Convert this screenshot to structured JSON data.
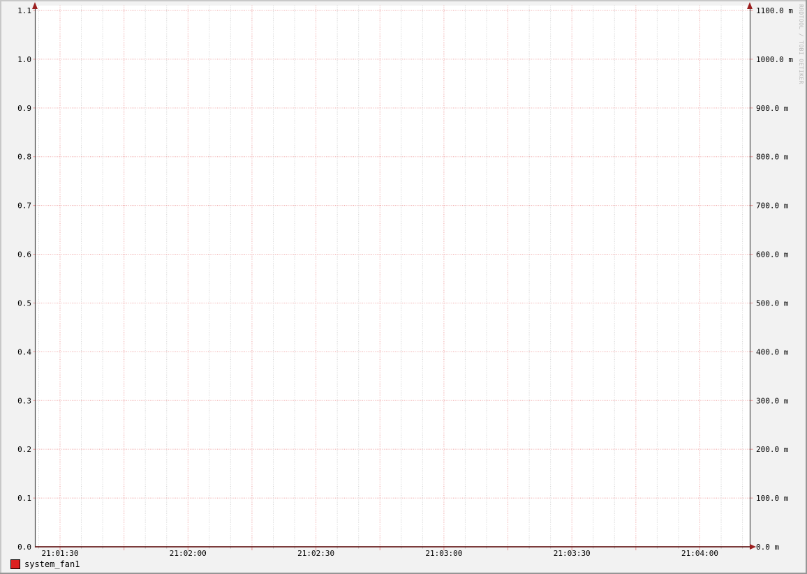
{
  "watermark": "RRDTOOL / TOBI OETIKER",
  "chart_data": {
    "type": "line",
    "title": "",
    "xlabel": "",
    "ylabel": "",
    "x_axis": {
      "labels": [
        "21:01:30",
        "21:02:00",
        "21:02:30",
        "21:03:00",
        "21:03:30",
        "21:04:00"
      ],
      "label_interval_seconds": 30,
      "major_grid_seconds": 15,
      "minor_grid_seconds": 5
    },
    "left_axis": {
      "range": [
        0.0,
        1.1
      ],
      "tick_step": 0.1,
      "tick_labels": [
        "0.0",
        "0.1",
        "0.2",
        "0.3",
        "0.4",
        "0.5",
        "0.6",
        "0.7",
        "0.8",
        "0.9",
        "1.0",
        "1.1"
      ]
    },
    "right_axis": {
      "range_milli": [
        0,
        1100
      ],
      "tick_step_milli": 100,
      "unit": "m",
      "tick_labels": [
        "0.0 m",
        "100.0 m",
        "200.0 m",
        "300.0 m",
        "400.0 m",
        "500.0 m",
        "600.0 m",
        "700.0 m",
        "800.0 m",
        "900.0 m",
        "1000.0 m",
        "1100.0 m"
      ]
    },
    "series": [
      {
        "name": "system_fan1",
        "color": "#dd2020",
        "x": [
          "21:01:30",
          "21:02:00",
          "21:02:30",
          "21:03:00",
          "21:03:30",
          "21:04:00"
        ],
        "values": [
          0,
          0,
          0,
          0,
          0,
          0
        ]
      }
    ],
    "legend_position": "bottom-left",
    "grid": {
      "style": "dotted",
      "major_color": "#efa2a2",
      "minor_color": "#d4d4d4"
    },
    "colors": {
      "background": "#f2f2f2",
      "canvas": "#ffffff",
      "shade_top_left": "#c8c8c8",
      "shade_bottom_right": "#969696",
      "axis": "#4d4d4d",
      "x_axis_line": "#6a2121",
      "arrow": "#9b1f1f",
      "tick_major": "#e89090",
      "tick_minor": "#b9b9b9",
      "text": "#000000",
      "watermark_text": "#b9b9b9"
    }
  }
}
